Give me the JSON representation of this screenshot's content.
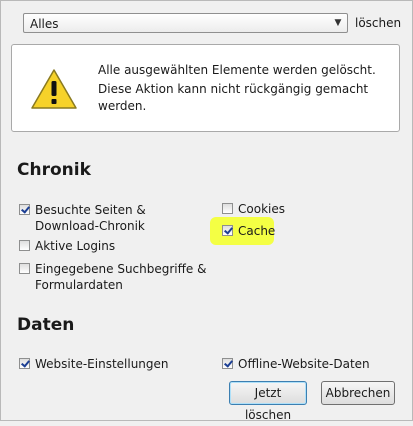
{
  "top": {
    "range_select_value": "Alles",
    "range_label": "löschen"
  },
  "warning": {
    "line1": "Alle ausgewählten Elemente werden gelöscht.",
    "line2": "Diese Aktion kann nicht rückgängig gemacht werden.",
    "icon": "warning-triangle-icon"
  },
  "chronik": {
    "title": "Chronik",
    "items": [
      {
        "label": "Besuchte Seiten & Download-Chronik",
        "checked": true
      },
      {
        "label": "Aktive Logins",
        "checked": false
      },
      {
        "label": "Eingegebene Suchbegriffe & Formulardaten",
        "checked": false
      },
      {
        "label": "Cookies",
        "checked": false
      },
      {
        "label": "Cache",
        "checked": true
      }
    ]
  },
  "daten": {
    "title": "Daten",
    "items": [
      {
        "label": "Website-Einstellungen",
        "checked": true
      },
      {
        "label": "Offline-Website-Daten",
        "checked": true
      }
    ]
  },
  "buttons": {
    "clear_now": "Jetzt löschen",
    "cancel": "Abbrechen"
  },
  "colors": {
    "highlight": "#f3ff3a",
    "check": "#1c3f94",
    "warning_fill": "#f6d22a"
  }
}
